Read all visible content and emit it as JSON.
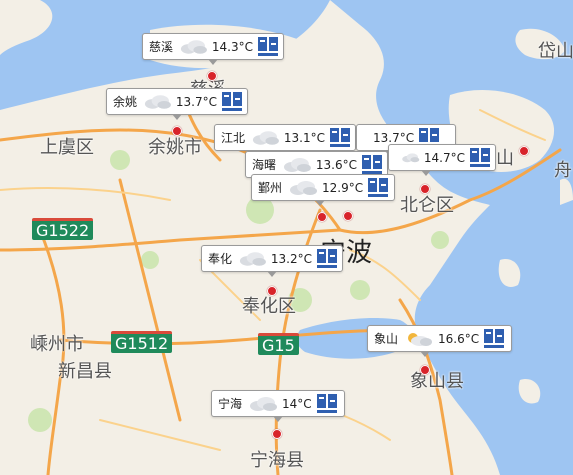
{
  "map": {
    "colors": {
      "land": "#f3efe6",
      "water": "#9ec5f2",
      "park": "#cfe6b4",
      "road": "#f4a64a",
      "marker": "#d8232a"
    },
    "places": {
      "shangyu": "上虞区",
      "yuyao": "余姚市",
      "ningbo": "宁波",
      "beilun": "北仑区",
      "fenghua": "奉化区",
      "shengzhou": "嵊州市",
      "xinchang": "新昌县",
      "xiangshan": "象山县",
      "ninghai": "宁海县",
      "cixi_partial": "慈溪",
      "daishan_partial": "岱山",
      "zhoushan_partial": "舟",
      "dinghai_partial": "定山"
    },
    "road_shields": [
      "G1522",
      "G1512",
      "G15"
    ]
  },
  "weather_markers": [
    {
      "name": "慈溪",
      "temp": "14.3°C",
      "icon": "cloudy-icon"
    },
    {
      "name": "余姚",
      "temp": "13.7°C",
      "icon": "cloudy-icon"
    },
    {
      "name": "江北",
      "temp": "13.1°C",
      "icon": "cloudy-icon"
    },
    {
      "name": "",
      "temp": "13.7°C",
      "icon": "cloudy-icon"
    },
    {
      "name": "海曙",
      "temp": "13.6°C",
      "icon": "cloudy-icon"
    },
    {
      "name": "",
      "temp": "14.7°C",
      "icon": "cloudy-icon"
    },
    {
      "name": "鄞州",
      "temp": "12.9°C",
      "icon": "cloudy-icon"
    },
    {
      "name": "奉化",
      "temp": "13.2°C",
      "icon": "cloudy-icon"
    },
    {
      "name": "象山",
      "temp": "16.6°C",
      "icon": "partly-cloudy-icon"
    },
    {
      "name": "宁海",
      "temp": "14°C",
      "icon": "cloudy-icon"
    }
  ]
}
